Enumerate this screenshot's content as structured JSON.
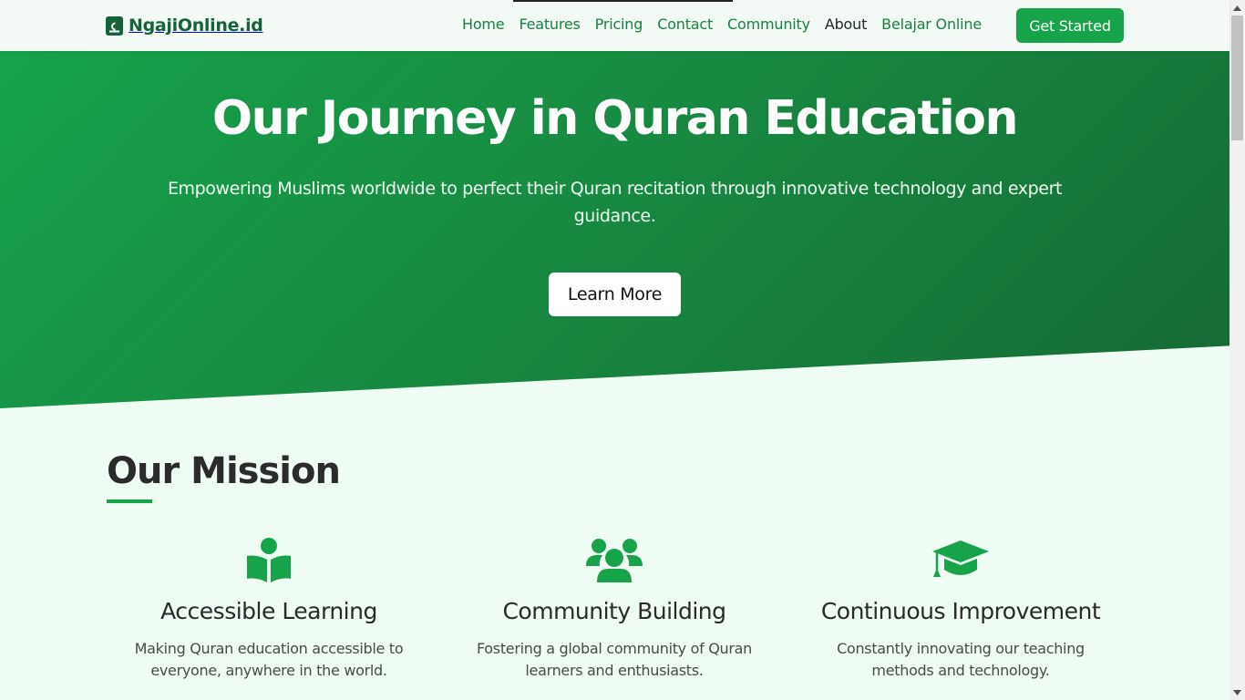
{
  "header": {
    "brand": "NgajiOnline.id",
    "nav": [
      {
        "label": "Home",
        "active": false
      },
      {
        "label": "Features",
        "active": false
      },
      {
        "label": "Pricing",
        "active": false
      },
      {
        "label": "Contact",
        "active": false
      },
      {
        "label": "Community",
        "active": false
      },
      {
        "label": "About",
        "active": true
      },
      {
        "label": "Belajar Online",
        "active": false
      }
    ],
    "cta": "Get Started"
  },
  "hero": {
    "title": "Our Journey in Quran Education",
    "subtitle": "Empowering Muslims worldwide to perfect their Quran recitation through innovative technology and expert guidance.",
    "button": "Learn More"
  },
  "mission": {
    "title": "Our Mission",
    "cards": [
      {
        "icon": "book-reader-icon",
        "title": "Accessible Learning",
        "text": "Making Quran education accessible to everyone, anywhere in the world."
      },
      {
        "icon": "users-icon",
        "title": "Community Building",
        "text": "Fostering a global community of Quran learners and enthusiasts."
      },
      {
        "icon": "graduation-cap-icon",
        "title": "Continuous Improvement",
        "text": "Constantly innovating our teaching methods and technology."
      }
    ]
  },
  "colors": {
    "brand_green": "#16a34a",
    "dark_green": "#16633a",
    "nav_green": "#18813f",
    "background": "#effcf4"
  }
}
